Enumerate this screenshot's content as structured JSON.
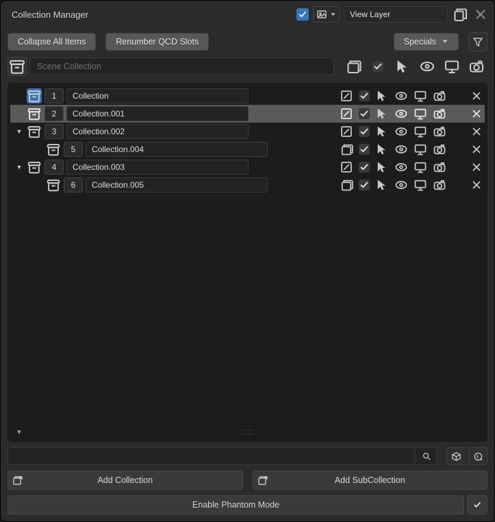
{
  "title": "Collection Manager",
  "view_layer_field": "View Layer",
  "toolbar": {
    "collapse": "Collapse All Items",
    "renumber": "Renumber QCD Slots",
    "specials": "Specials"
  },
  "scene_field": "Scene Collection",
  "rows": [
    {
      "slot": "1",
      "name": "Collection",
      "indent": 0,
      "expand": "",
      "hi": true,
      "selected": false
    },
    {
      "slot": "2",
      "name": "Collection.001",
      "indent": 0,
      "expand": "",
      "hi": false,
      "selected": true
    },
    {
      "slot": "3",
      "name": "Collection.002",
      "indent": 0,
      "expand": "▼",
      "hi": false,
      "selected": false
    },
    {
      "slot": "5",
      "name": "Collection.004",
      "indent": 1,
      "expand": "",
      "hi": false,
      "selected": false
    },
    {
      "slot": "4",
      "name": "Collection.003",
      "indent": 0,
      "expand": "▼",
      "hi": false,
      "selected": false
    },
    {
      "slot": "6",
      "name": "Collection.005",
      "indent": 1,
      "expand": "",
      "hi": false,
      "selected": false
    }
  ],
  "footer": {
    "add_collection": "Add Collection",
    "add_subcollection": "Add SubCollection",
    "phantom": "Enable Phantom Mode"
  }
}
